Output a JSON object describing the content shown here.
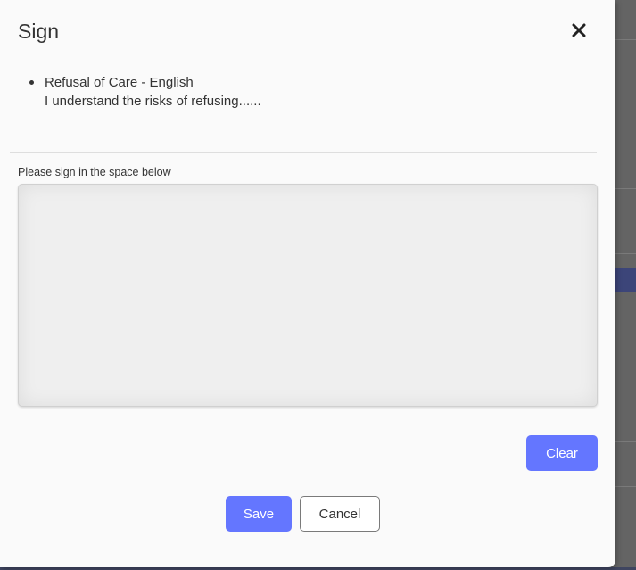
{
  "dialog": {
    "title": "Sign",
    "close_icon": "close-icon",
    "items": [
      {
        "title": "Refusal of Care - English",
        "description": "I understand the risks of refusing......"
      }
    ],
    "signature": {
      "label": "Please sign in the space below"
    },
    "buttons": {
      "clear": "Clear",
      "save": "Save",
      "cancel": "Cancel"
    }
  },
  "colors": {
    "primary": "#6476ff",
    "backdrop": "#646464",
    "modal_background": "#fafafa",
    "text": "#333333"
  }
}
